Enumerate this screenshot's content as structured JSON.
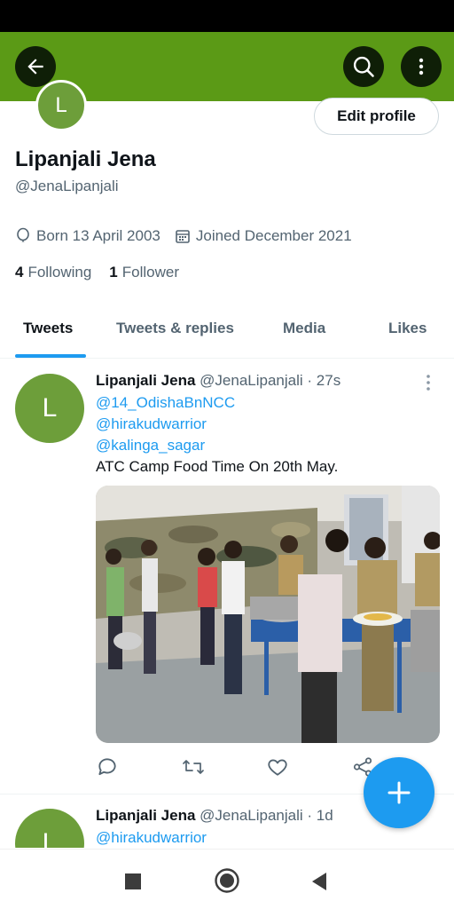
{
  "app_bar": {
    "color": "#5b9a16"
  },
  "profile": {
    "avatar_letter": "L",
    "name": "Lipanjali Jena",
    "handle": "@JenaLipanjali",
    "born": "Born 13 April 2003",
    "joined": "Joined December 2021",
    "following_count": "4",
    "following_label": "Following",
    "followers_count": "1",
    "followers_label": "Follower",
    "edit_profile_label": "Edit profile"
  },
  "tabs": [
    {
      "label": "Tweets",
      "active": true
    },
    {
      "label": "Tweets & replies",
      "active": false
    },
    {
      "label": "Media",
      "active": false
    },
    {
      "label": "Likes",
      "active": false
    }
  ],
  "tweets": [
    {
      "avatar_letter": "L",
      "name": "Lipanjali Jena",
      "handle_time": "@JenaLipanjali · 27s",
      "mentions": [
        "@14_OdishaBnNCC",
        "@hirakudwarrior",
        "@kalinga_sagar"
      ],
      "text": "ATC Camp Food Time On 20th May."
    },
    {
      "avatar_letter": "L",
      "name": "Lipanjali Jena",
      "handle_time": "@JenaLipanjali · 1d",
      "mentions": [
        "@hirakudwarrior"
      ]
    }
  ],
  "icons": {
    "back": "arrow-left-icon",
    "search": "search-icon",
    "more": "more-vertical-icon",
    "reply": "reply-icon",
    "retweet": "retweet-icon",
    "like": "heart-icon",
    "share": "share-icon",
    "compose": "plus-icon"
  },
  "accent": "#1d9bf0"
}
